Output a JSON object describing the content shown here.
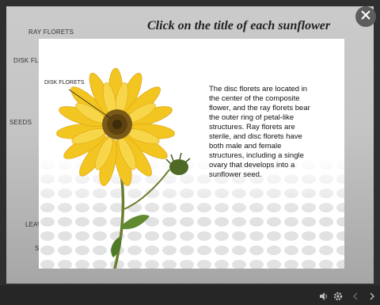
{
  "slide": {
    "title": "Click on the title of each sunflower",
    "labels": {
      "ray_florets": "RAY FLORETS",
      "disk_florets": "DISK FLO",
      "seeds": "SEEDS",
      "leaves": "LEAV",
      "stem": "S"
    }
  },
  "modal": {
    "image_label": "DISK FLORETS",
    "description": "The disc florets are located in the center of the composite flower, and the ray florets bear the outer ring of petal-like structures. Ray florets are sterile, and disc florets have both male and female structures, including a single ovary that develops into a sunflower seed."
  },
  "icons": {
    "close": "close-icon",
    "volume": "volume-icon",
    "settings": "gear-icon",
    "prev": "chevron-left-icon",
    "next": "chevron-right-icon"
  },
  "colors": {
    "petal": "#f3c520",
    "disk": "#7a5a16",
    "stem": "#6b7f2e"
  }
}
